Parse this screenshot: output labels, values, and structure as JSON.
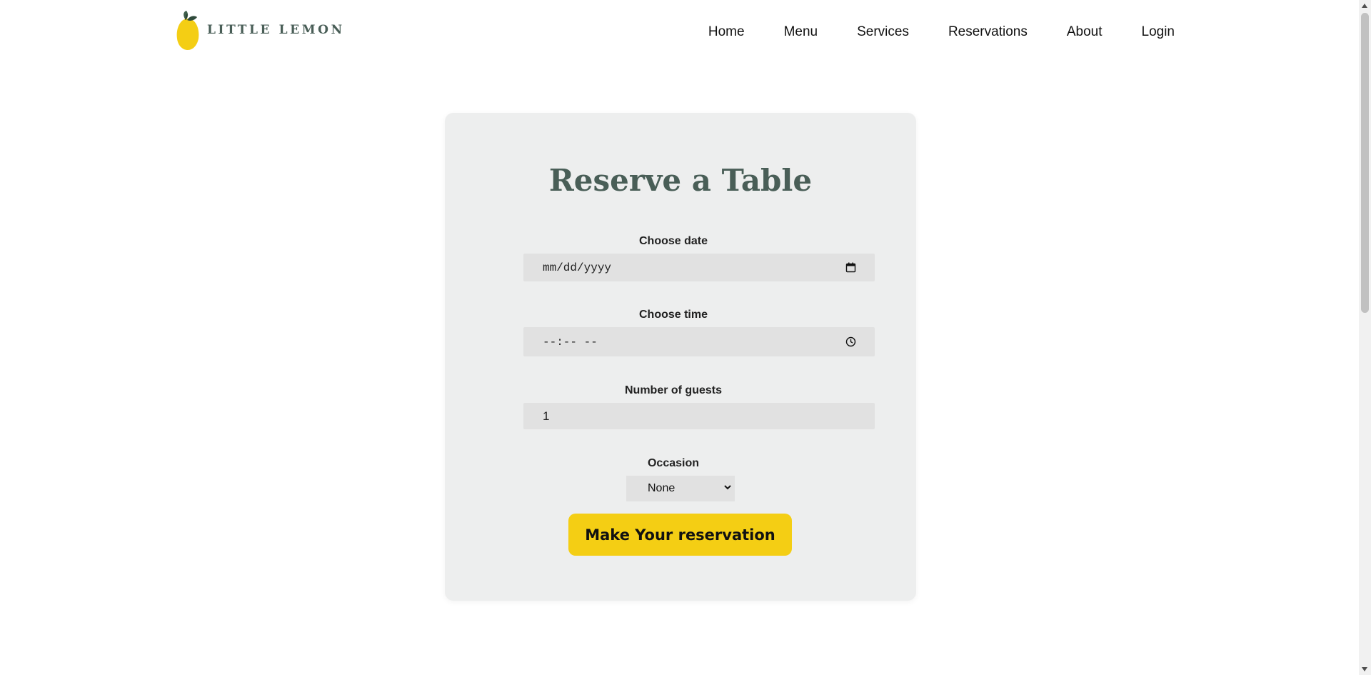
{
  "header": {
    "logo_text": "LITTLE LEMON",
    "nav": [
      "Home",
      "Menu",
      "Services",
      "Reservations",
      "About",
      "Login"
    ]
  },
  "form": {
    "title": "Reserve a Table",
    "date": {
      "label": "Choose date",
      "placeholder": "mm/dd/yyyy",
      "icon": "calendar-icon"
    },
    "time": {
      "label": "Choose time",
      "placeholder": "--:-- --",
      "icon": "clock-icon"
    },
    "guests": {
      "label": "Number of guests",
      "value": "1"
    },
    "occasion": {
      "label": "Occasion",
      "selected": "None"
    },
    "submit_label": "Make Your reservation"
  },
  "colors": {
    "brand_green": "#495e57",
    "brand_yellow": "#f4ce14",
    "card_bg": "#edeeee",
    "field_bg": "#e1e1e1"
  }
}
